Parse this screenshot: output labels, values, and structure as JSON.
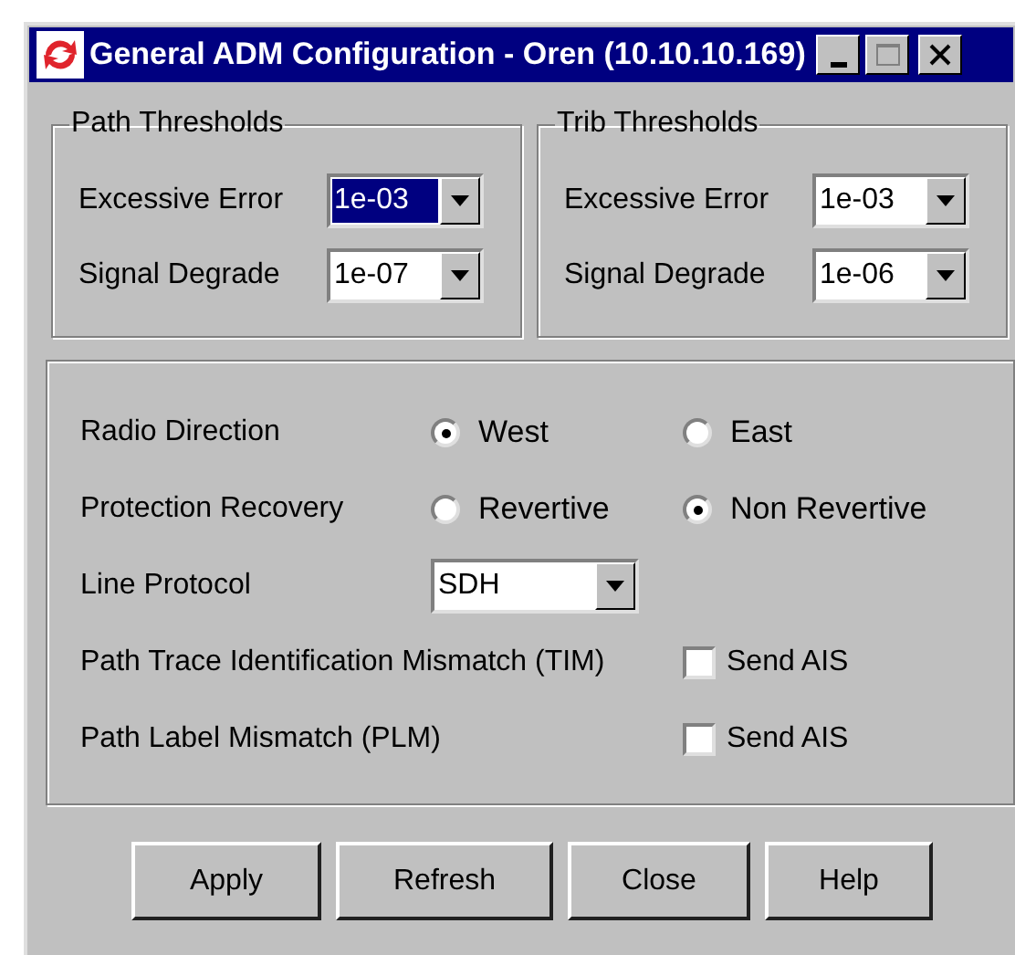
{
  "window": {
    "title": "General ADM Configuration - Oren (10.10.10.169)"
  },
  "threshold_groups": [
    {
      "title": "Path Thresholds",
      "fields": [
        {
          "label": "Excessive Error",
          "value": "1e-03",
          "selected": true
        },
        {
          "label": "Signal Degrade",
          "value": "1e-07",
          "selected": false
        }
      ]
    },
    {
      "title": "Trib Thresholds",
      "fields": [
        {
          "label": "Excessive Error",
          "value": "1e-03",
          "selected": false
        },
        {
          "label": "Signal Degrade",
          "value": "1e-06",
          "selected": false
        }
      ]
    }
  ],
  "settings": [
    {
      "kind": "radio",
      "label": "Radio Direction",
      "options": [
        {
          "label": "West",
          "selected": true
        },
        {
          "label": "East",
          "selected": false
        }
      ]
    },
    {
      "kind": "radio",
      "label": "Protection Recovery",
      "options": [
        {
          "label": "Revertive",
          "selected": false
        },
        {
          "label": "Non Revertive",
          "selected": true
        }
      ]
    },
    {
      "kind": "dropdown",
      "label": "Line Protocol",
      "value": "SDH"
    },
    {
      "kind": "checkbox",
      "label": "Path Trace Identification Mismatch (TIM)",
      "option": "Send AIS",
      "checked": false
    },
    {
      "kind": "checkbox",
      "label": "Path Label Mismatch (PLM)",
      "option": "Send AIS",
      "checked": false
    }
  ],
  "buttons": [
    "Apply",
    "Refresh",
    "Close",
    "Help"
  ]
}
